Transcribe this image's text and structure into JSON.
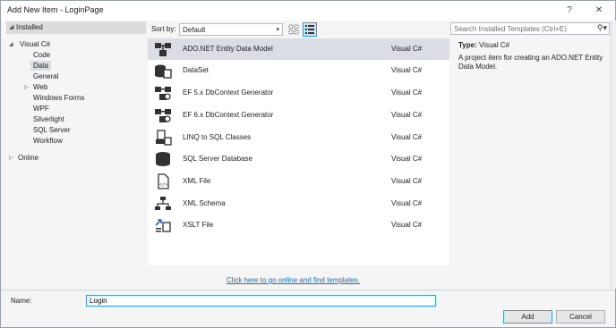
{
  "window": {
    "title": "Add New Item - LoginPage",
    "help_glyph": "?",
    "close_glyph": "✕"
  },
  "tree": {
    "header": "Installed",
    "items": [
      {
        "label": "Visual C#",
        "expanded": true
      },
      {
        "label": "Code"
      },
      {
        "label": "Data",
        "selected": true
      },
      {
        "label": "General"
      },
      {
        "label": "Web",
        "collapsed": true
      },
      {
        "label": "Windows Forms"
      },
      {
        "label": "WPF"
      },
      {
        "label": "Silverlight"
      },
      {
        "label": "SQL Server"
      },
      {
        "label": "Workflow"
      }
    ],
    "online": "Online"
  },
  "toolbar": {
    "sort_label": "Sort by:",
    "sort_value": "Default",
    "search_placeholder": "Search Installed Templates (Ctrl+E)"
  },
  "templates": [
    {
      "name": "ADO.NET Entity Data Model",
      "lang": "Visual C#",
      "icon": "entity-model-icon",
      "selected": true
    },
    {
      "name": "DataSet",
      "lang": "Visual C#",
      "icon": "dataset-icon"
    },
    {
      "name": "EF 5.x DbContext Generator",
      "lang": "Visual C#",
      "icon": "dbcontext-generator-icon"
    },
    {
      "name": "EF 6.x DbContext Generator",
      "lang": "Visual C#",
      "icon": "dbcontext-generator-icon"
    },
    {
      "name": "LINQ to SQL Classes",
      "lang": "Visual C#",
      "icon": "linq-to-sql-icon"
    },
    {
      "name": "SQL Server Database",
      "lang": "Visual C#",
      "icon": "database-icon"
    },
    {
      "name": "XML File",
      "lang": "Visual C#",
      "icon": "xml-file-icon"
    },
    {
      "name": "XML Schema",
      "lang": "Visual C#",
      "icon": "xml-schema-icon"
    },
    {
      "name": "XSLT File",
      "lang": "Visual C#",
      "icon": "xslt-file-icon"
    }
  ],
  "online_link": "Click here to go online and find templates.",
  "details": {
    "type_label": "Type:",
    "type_value": "Visual C#",
    "description": "A project item for creating an ADO.NET Entity Data Model."
  },
  "footer": {
    "name_label": "Name:",
    "name_value": "Login",
    "add_label": "Add",
    "cancel_label": "Cancel"
  },
  "colors": {
    "accent": "#3399ff",
    "selection": "#dadde3",
    "link": "#0e70c0"
  }
}
